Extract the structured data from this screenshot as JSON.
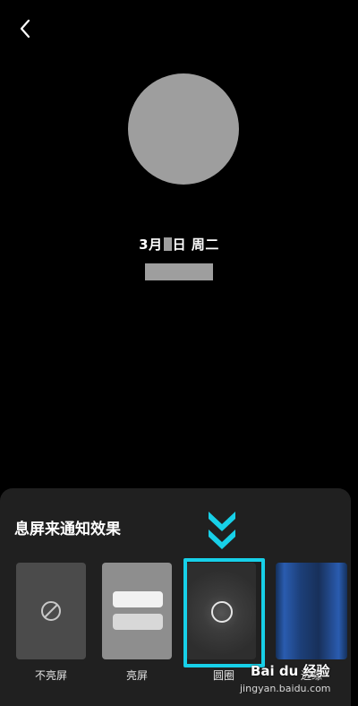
{
  "header": {
    "back_icon": "chevron-left-icon"
  },
  "lockscreen": {
    "date_prefix": "3月",
    "date_suffix": "日 周二"
  },
  "sheet": {
    "title": "息屏来通知效果",
    "options": [
      {
        "label": "不亮屏",
        "icon": "prohibited-icon"
      },
      {
        "label": "亮屏",
        "icon": "screen-on-icon"
      },
      {
        "label": "圆圈",
        "icon": "circle-icon"
      },
      {
        "label": "边缘",
        "icon": "edge-glow-icon"
      }
    ],
    "selected_index": 2,
    "highlight_color": "#17d0e8"
  },
  "watermark": {
    "brand": "Bai du 经验",
    "url": "jingyan.baidu.com"
  }
}
